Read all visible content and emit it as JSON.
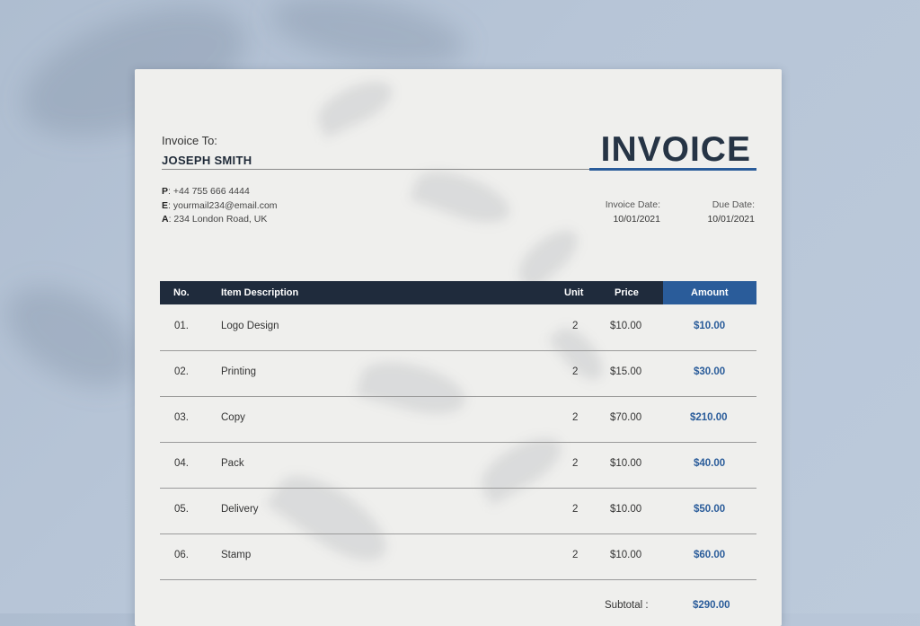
{
  "invoice": {
    "title": "INVOICE",
    "to_label": "Invoice To:",
    "client_name": "JOSEPH SMITH",
    "contact": {
      "phone_key": "P",
      "phone": ": +44 755 666 4444",
      "email_key": "E",
      "email": ": yourmail234@email.com",
      "address_key": "A",
      "address": ": 234 London Road, UK"
    },
    "invoice_date_label": "Invoice Date:",
    "invoice_date": "10/01/2021",
    "due_date_label": "Due Date:",
    "due_date": "10/01/2021"
  },
  "table": {
    "headers": {
      "no": "No.",
      "desc": "Item Description",
      "unit": "Unit",
      "price": "Price",
      "amount": "Amount"
    },
    "rows": [
      {
        "no": "01.",
        "desc": "Logo Design",
        "unit": "2",
        "price": "$10.00",
        "amount": "$10.00"
      },
      {
        "no": "02.",
        "desc": "Printing",
        "unit": "2",
        "price": "$15.00",
        "amount": "$30.00"
      },
      {
        "no": "03.",
        "desc": "Copy",
        "unit": "2",
        "price": "$70.00",
        "amount": "$210.00"
      },
      {
        "no": "04.",
        "desc": "Pack",
        "unit": "2",
        "price": "$10.00",
        "amount": "$40.00"
      },
      {
        "no": "05.",
        "desc": "Delivery",
        "unit": "2",
        "price": "$10.00",
        "amount": "$50.00"
      },
      {
        "no": "06.",
        "desc": "Stamp",
        "unit": "2",
        "price": "$10.00",
        "amount": "$60.00"
      }
    ],
    "subtotal_label": "Subtotal :",
    "subtotal": "$290.00"
  },
  "colors": {
    "background": "#b7c5d7",
    "paper": "#efefed",
    "header_dark": "#1f2b3c",
    "accent": "#2a5c9a"
  }
}
